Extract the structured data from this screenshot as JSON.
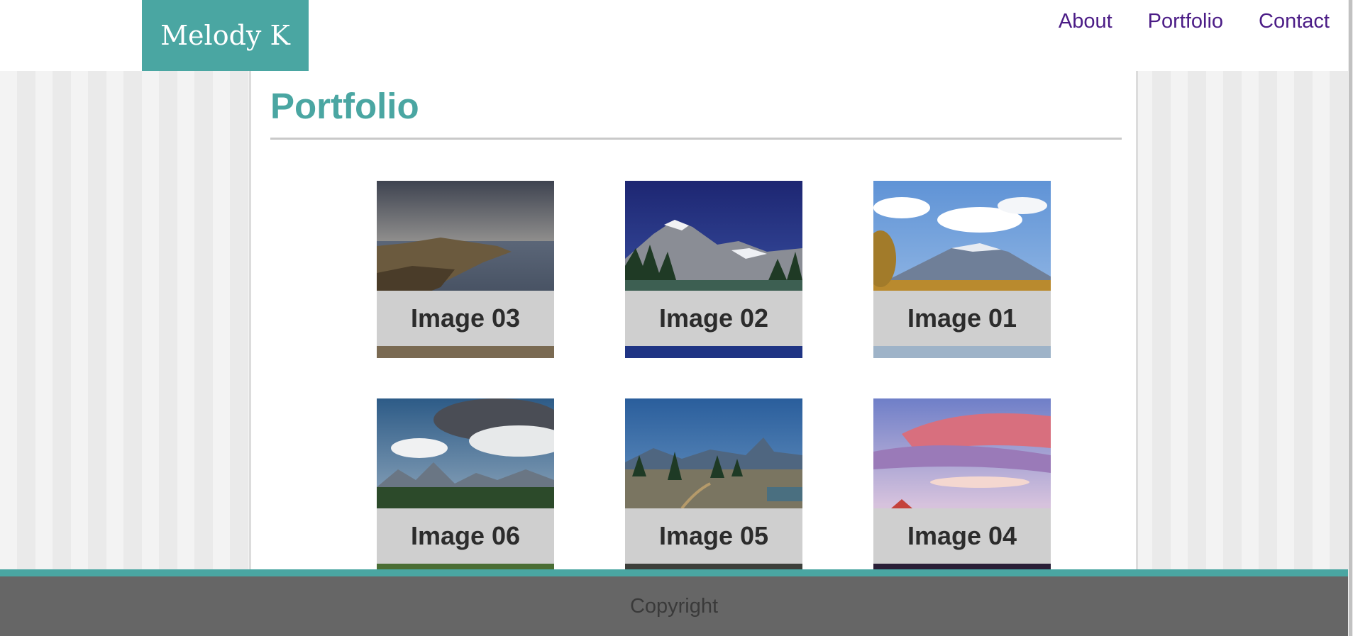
{
  "header": {
    "logo": "Melody K",
    "nav": [
      {
        "label": "About"
      },
      {
        "label": "Portfolio"
      },
      {
        "label": "Contact"
      }
    ]
  },
  "main": {
    "title": "Portfolio",
    "gallery": [
      {
        "label": "Image 03",
        "icon": "coastal-cliffs-image"
      },
      {
        "label": "Image 02",
        "icon": "snowy-mountain-lake-image"
      },
      {
        "label": "Image 01",
        "icon": "mountain-clouds-image"
      },
      {
        "label": "Image 06",
        "icon": "cloudy-mountain-range-image"
      },
      {
        "label": "Image 05",
        "icon": "alpine-trail-image"
      },
      {
        "label": "Image 04",
        "icon": "sunset-clouds-image"
      }
    ]
  },
  "footer": {
    "text": "Copyright"
  },
  "colors": {
    "accent": "#4aa6a2",
    "nav_link": "#4b1c86",
    "footer_bg": "#666666",
    "caption_bg": "#cfcfcf"
  }
}
